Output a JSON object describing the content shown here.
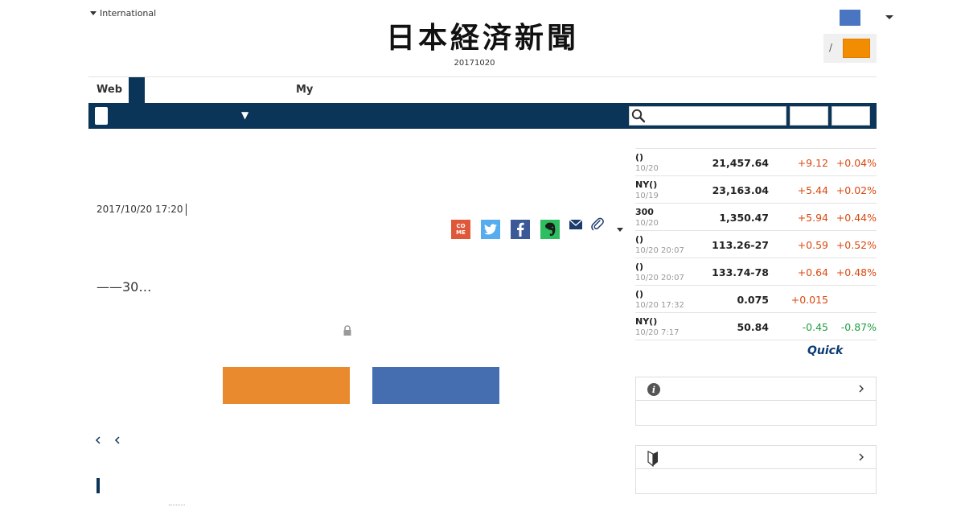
{
  "header": {
    "edition_label": "International",
    "logo_text": "日本経済新聞",
    "paper_date": "20171020",
    "login_separator": "/"
  },
  "tabs": {
    "web_label": "Web",
    "my_label": "My"
  },
  "nav": {
    "dropdown_symbol": "▼",
    "search_placeholder": ""
  },
  "article": {
    "date": "2017/10/20 17:20",
    "share_come_top": "CO",
    "share_come_bottom": "ME",
    "lead": "——30…"
  },
  "market": [
    {
      "name": "()",
      "date": "10/20",
      "value": "21,457.64",
      "change": "+9.12",
      "pct": "+0.04%",
      "dir": "up"
    },
    {
      "name": "NY()",
      "date": "10/19",
      "value": "23,163.04",
      "change": "+5.44",
      "pct": "+0.02%",
      "dir": "up"
    },
    {
      "name": "300",
      "date": "10/20",
      "value": "1,350.47",
      "change": "+5.94",
      "pct": "+0.44%",
      "dir": "up"
    },
    {
      "name": "()",
      "date": "10/20 20:07",
      "value": "113.26-27",
      "change": "+0.59",
      "pct": "+0.52%",
      "dir": "up"
    },
    {
      "name": "()",
      "date": "10/20 20:07",
      "value": "133.74-78",
      "change": "+0.64",
      "pct": "+0.48%",
      "dir": "up"
    },
    {
      "name": "()",
      "date": "10/20 17:32",
      "value": "0.075",
      "change": "+0.015",
      "pct": "",
      "dir": "up"
    },
    {
      "name": "NY()",
      "date": "10/20 7:17",
      "value": "50.84",
      "change": "-0.45",
      "pct": "-0.87%",
      "dir": "down"
    }
  ],
  "quick_logo": "Quick",
  "colors": {
    "navy": "#0b3558",
    "orange": "#ea8a2e",
    "blue": "#456eb1",
    "user_blue": "#4a76c1",
    "up": "#d9480f",
    "down": "#1e9e3e"
  },
  "icons": {
    "search": "search-icon",
    "lock": "lock-icon",
    "info": "info-icon",
    "beginner": "beginner-mark-icon"
  }
}
